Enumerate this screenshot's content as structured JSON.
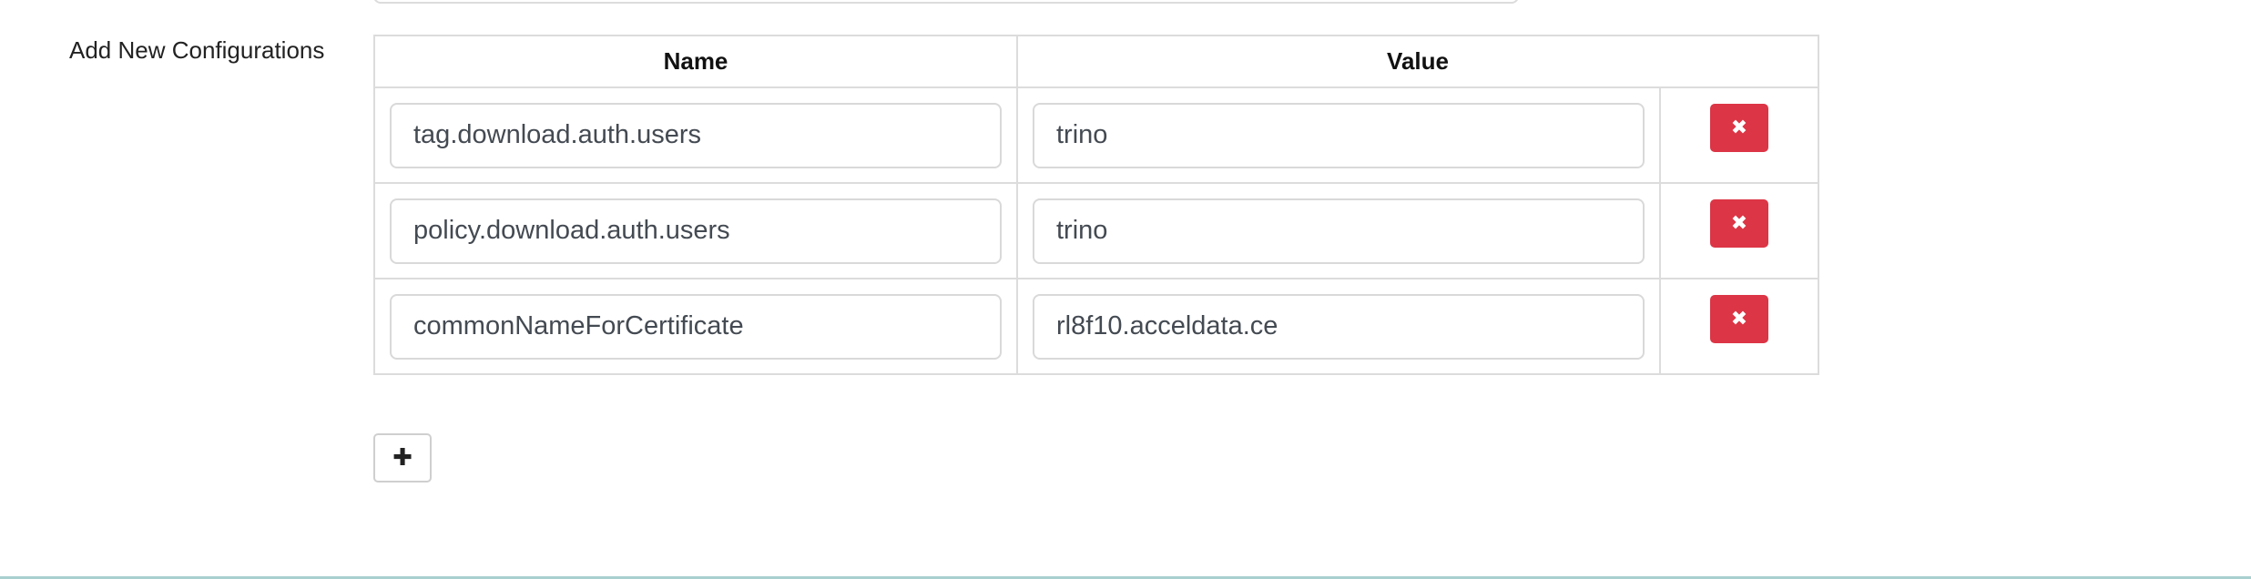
{
  "section": {
    "label": "Add New Configurations"
  },
  "table": {
    "headers": {
      "name": "Name",
      "value": "Value"
    },
    "rows": [
      {
        "name": "tag.download.auth.users",
        "value": "trino"
      },
      {
        "name": "policy.download.auth.users",
        "value": "trino"
      },
      {
        "name": "commonNameForCertificate",
        "value": "rl8f10.acceldata.ce"
      }
    ]
  },
  "buttons": {
    "remove_glyph": "✖",
    "add_glyph": "✚"
  },
  "colors": {
    "remove_button": "#dc3545",
    "border": "#dcdcdc",
    "bottom_rule": "#a9cfcf"
  },
  "icons": {
    "remove": "close-icon",
    "add": "plus-icon"
  }
}
